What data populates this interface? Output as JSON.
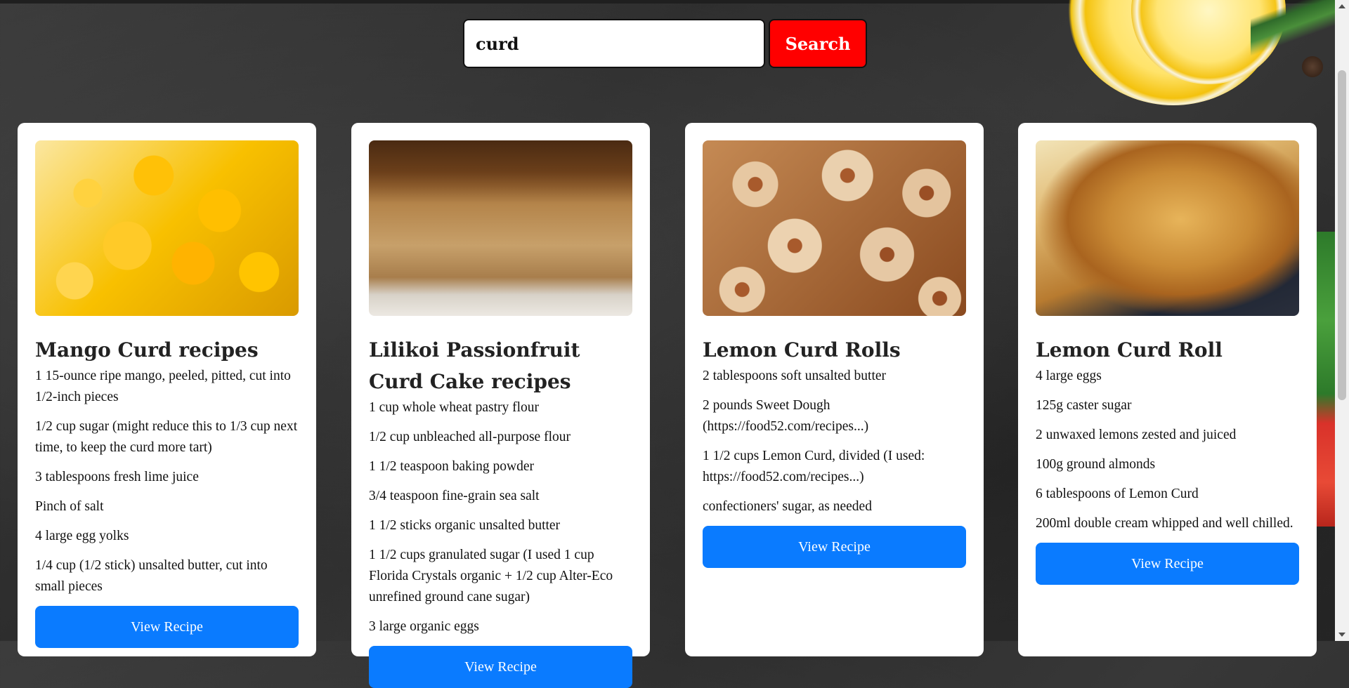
{
  "search": {
    "value": "curd",
    "button_label": "Search"
  },
  "cards": [
    {
      "title": "Mango Curd recipes",
      "image": "mango-cubes",
      "ingredients": [
        "1 15-ounce ripe mango, peeled, pitted, cut into 1/2-inch pieces",
        "1/2 cup sugar (might reduce this to 1/3 cup next time, to keep the curd more tart)",
        "3 tablespoons fresh lime juice",
        "Pinch of salt",
        "4 large egg yolks",
        "1/4 cup (1/2 stick) unsalted butter, cut into small pieces"
      ],
      "button_label": "View Recipe"
    },
    {
      "title": "Lilikoi Passionfruit Curd Cake recipes",
      "image": "passionfruit-cake",
      "ingredients": [
        "1 cup whole wheat pastry flour",
        "1/2 cup unbleached all-purpose flour",
        "1 1/2 teaspoon baking powder",
        "3/4 teaspoon fine-grain sea salt",
        "1 1/2 sticks organic unsalted butter",
        "1 1/2 cups granulated sugar (I used 1 cup Florida Crystals organic + 1/2 cup Alter-Eco unrefined ground cane sugar)",
        "3 large organic eggs"
      ],
      "button_label": "View Recipe"
    },
    {
      "title": "Lemon Curd Rolls",
      "image": "cinnamon-rolls",
      "ingredients": [
        "2 tablespoons soft unsalted butter",
        "2 pounds Sweet Dough (https://food52.com/recipes...)",
        "1 1/2 cups Lemon Curd, divided (I used: https://food52.com/recipes...)",
        "confectioners' sugar, as needed"
      ],
      "button_label": "View Recipe"
    },
    {
      "title": "Lemon Curd Roll",
      "image": "lemon-roll-cake",
      "ingredients": [
        "4 large eggs",
        "125g caster sugar",
        "2 unwaxed lemons zested and juiced",
        "100g ground almonds",
        "6 tablespoons of Lemon Curd",
        "200ml double cream whipped and well chilled."
      ],
      "button_label": "View Recipe"
    }
  ],
  "colors": {
    "search_button": "#ff0000",
    "view_button": "#0a7bff",
    "card_bg": "#ffffff"
  }
}
